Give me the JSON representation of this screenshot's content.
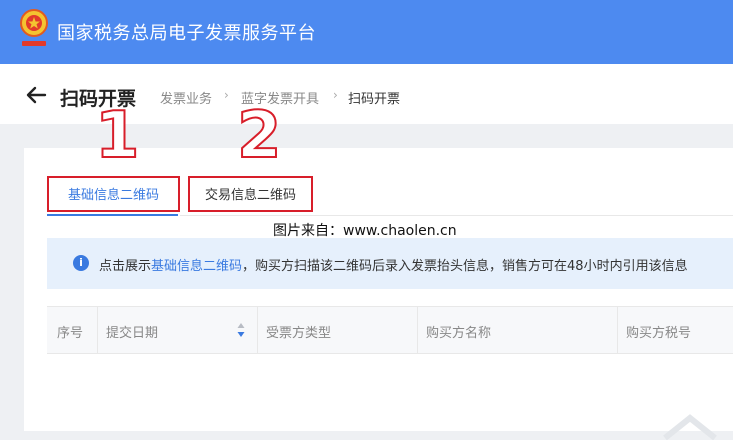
{
  "header": {
    "app_title": "国家税务总局电子发票服务平台",
    "emblem_icon": "tax-emblem-icon"
  },
  "page": {
    "title": "扫码开票",
    "back_icon": "arrow-left-icon"
  },
  "breadcrumb": [
    "发票业务",
    "蓝字发票开具",
    "扫码开票"
  ],
  "annotations": [
    "1",
    "2"
  ],
  "tabs": [
    {
      "label": "基础信息二维码",
      "active": true
    },
    {
      "label": "交易信息二维码",
      "active": false
    }
  ],
  "watermark": "图片来自：www.chaolen.cn",
  "notice": {
    "prefix": "点击展示",
    "highlight": "基础信息二维码",
    "suffix": "，购买方扫描该二维码后录入发票抬头信息，销售方可在48小时内引用该信息"
  },
  "table": {
    "columns": [
      "序号",
      "提交日期",
      "受票方类型",
      "购买方名称",
      "购买方税号"
    ]
  },
  "colors": {
    "header_blue": "#4d8af0",
    "accent": "#3a7ae0",
    "annotation_red": "#d81e2a",
    "notice_bg": "#e6f0fc"
  }
}
